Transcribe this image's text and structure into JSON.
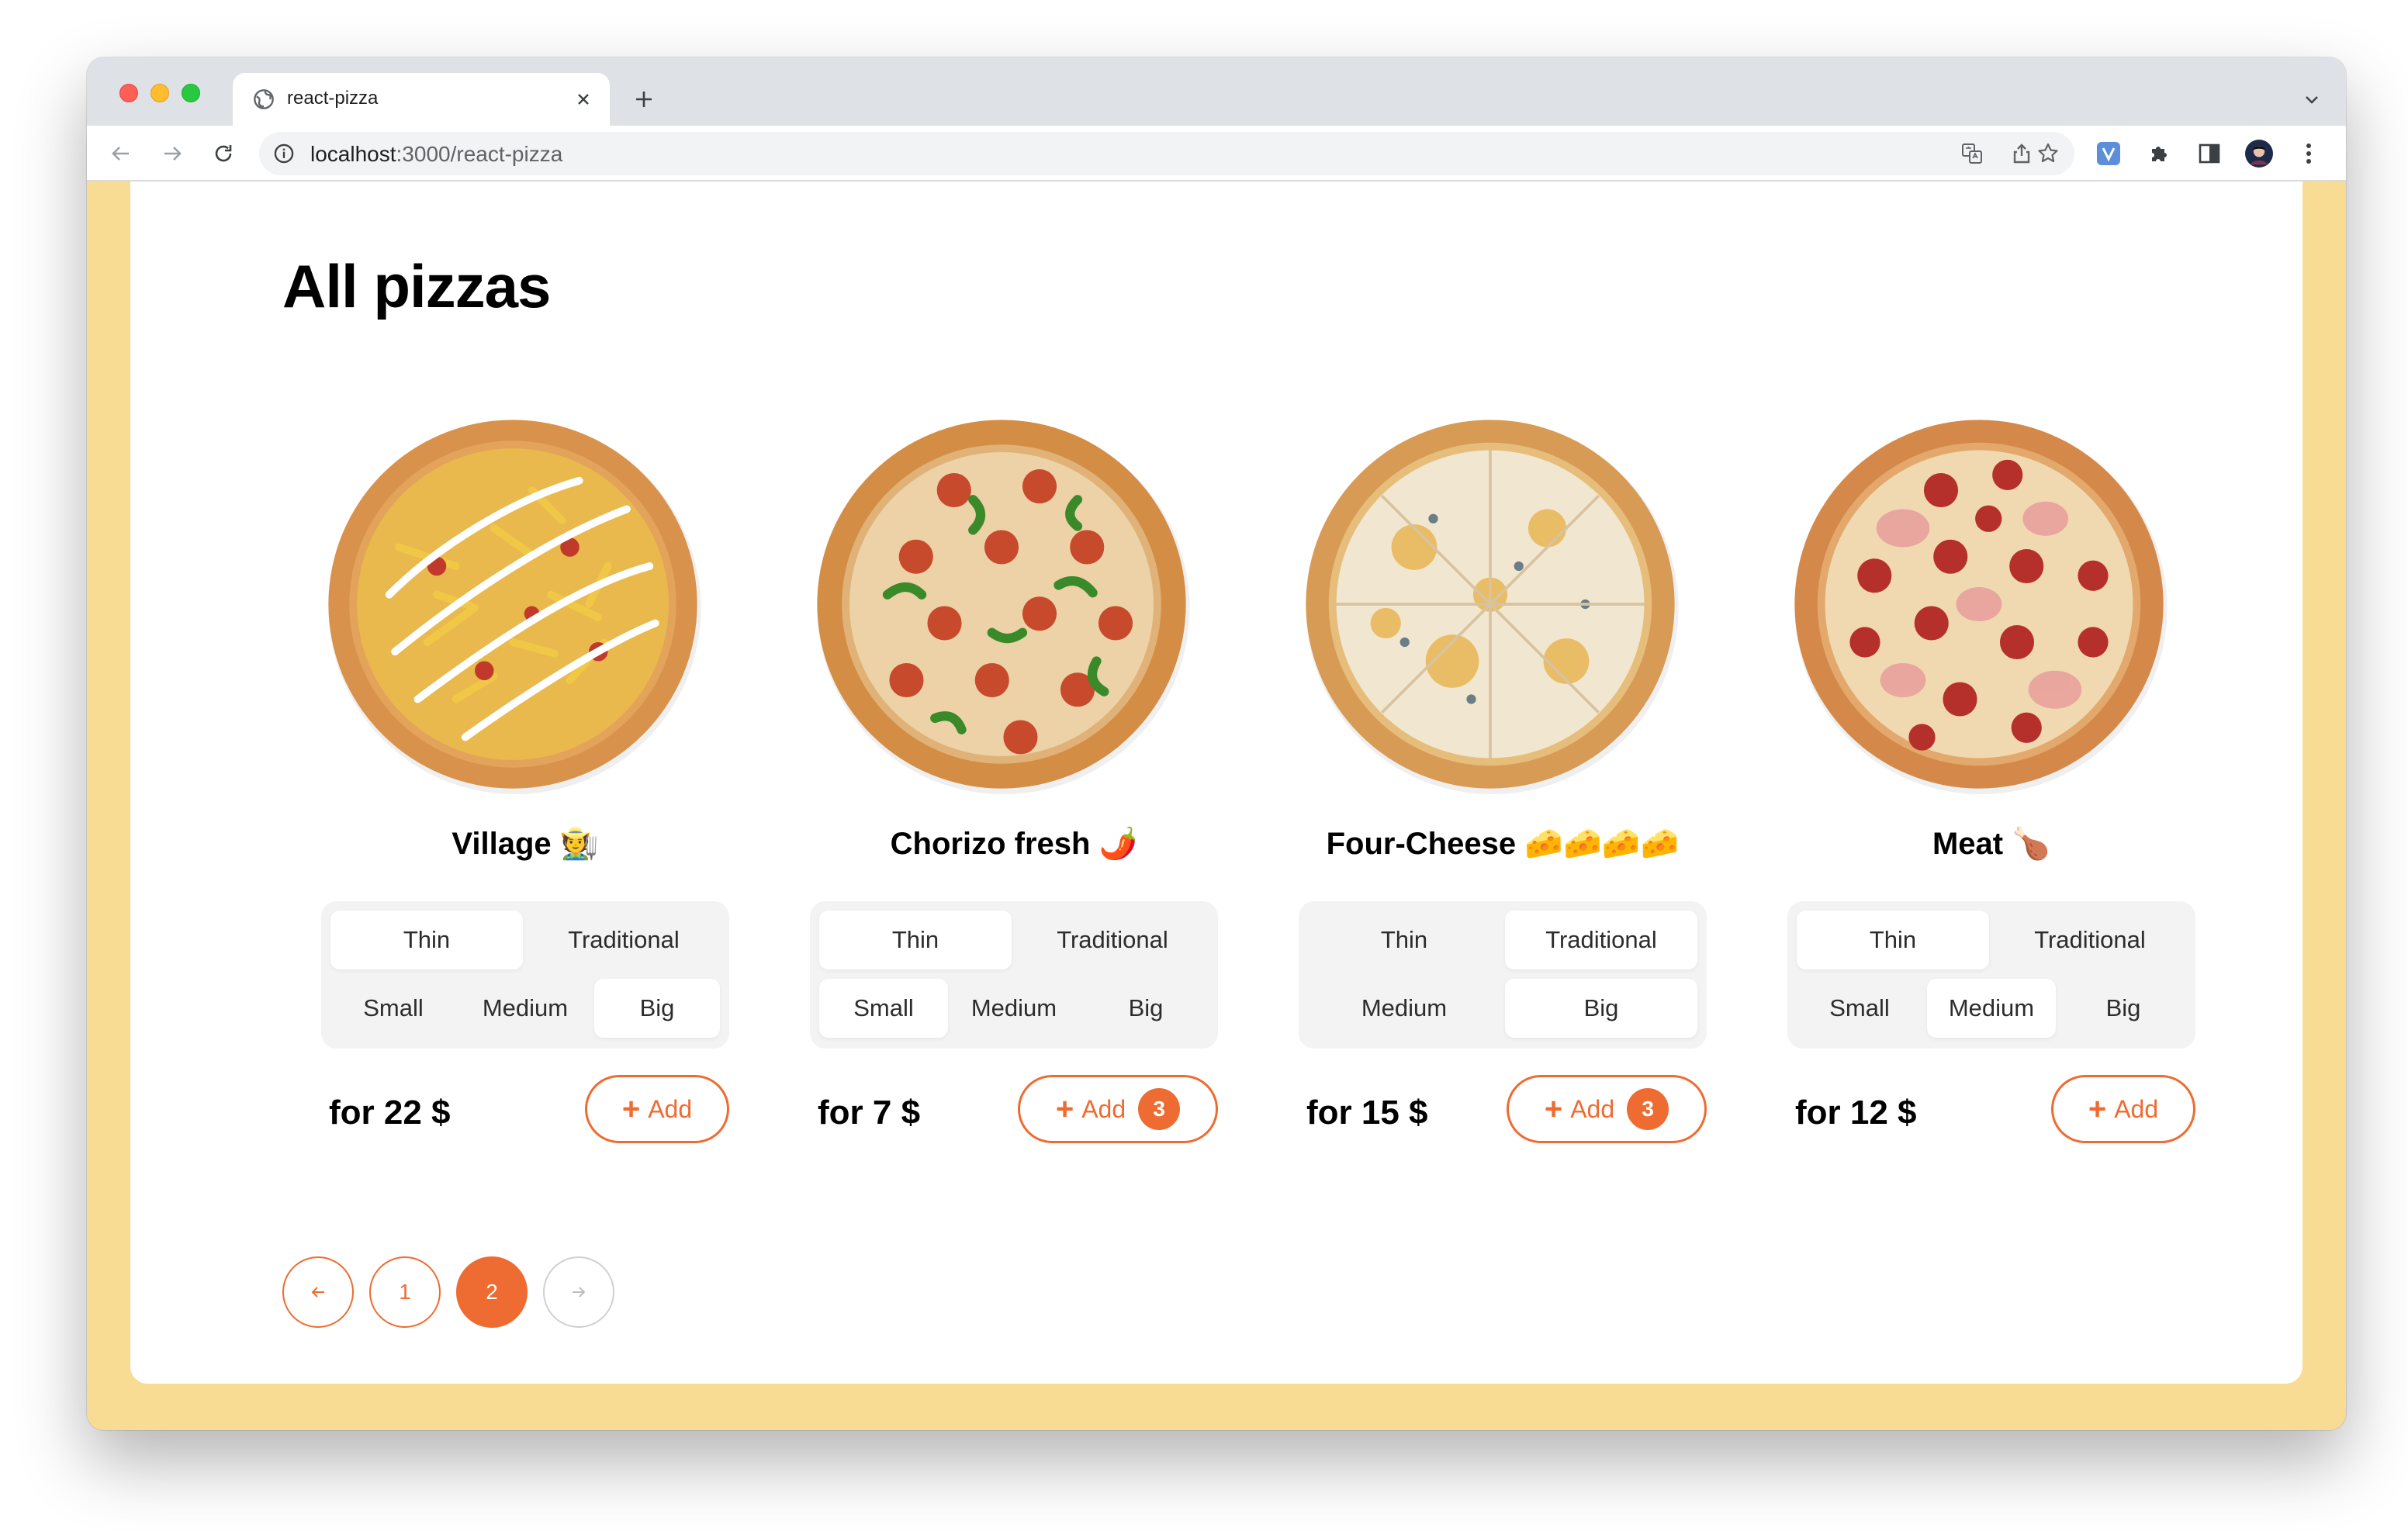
{
  "browser": {
    "tab_title": "react-pizza",
    "url_host": "localhost",
    "url_rest": ":3000/react-pizza"
  },
  "page": {
    "title": "All pizzas"
  },
  "pizzas": [
    {
      "name": "Village 🧑‍🌾",
      "types": [
        "Thin",
        "Traditional"
      ],
      "active_type": 0,
      "sizes": [
        "Small",
        "Medium",
        "Big"
      ],
      "active_size": 2,
      "price": "for 22 $",
      "add_label": "Add",
      "count": null,
      "topping": "village"
    },
    {
      "name": "Chorizo fresh 🌶️",
      "types": [
        "Thin",
        "Traditional"
      ],
      "active_type": 0,
      "sizes": [
        "Small",
        "Medium",
        "Big"
      ],
      "active_size": 0,
      "price": "for 7 $",
      "add_label": "Add",
      "count": "3",
      "topping": "chorizo"
    },
    {
      "name": "Four-Cheese 🧀🧀🧀🧀",
      "types": [
        "Thin",
        "Traditional"
      ],
      "active_type": 1,
      "sizes": [
        "Medium",
        "Big"
      ],
      "active_size": 1,
      "price": "for 15 $",
      "add_label": "Add",
      "count": "3",
      "topping": "cheese"
    },
    {
      "name": "Meat 🍗",
      "types": [
        "Thin",
        "Traditional"
      ],
      "active_type": 0,
      "sizes": [
        "Small",
        "Medium",
        "Big"
      ],
      "active_size": 1,
      "price": "for 12 $",
      "add_label": "Add",
      "count": null,
      "topping": "meat"
    }
  ],
  "pagination": {
    "pages": [
      "1",
      "2"
    ],
    "current": "2"
  },
  "colors": {
    "accent": "#ee6b31",
    "page_bg": "#f8dc93"
  }
}
